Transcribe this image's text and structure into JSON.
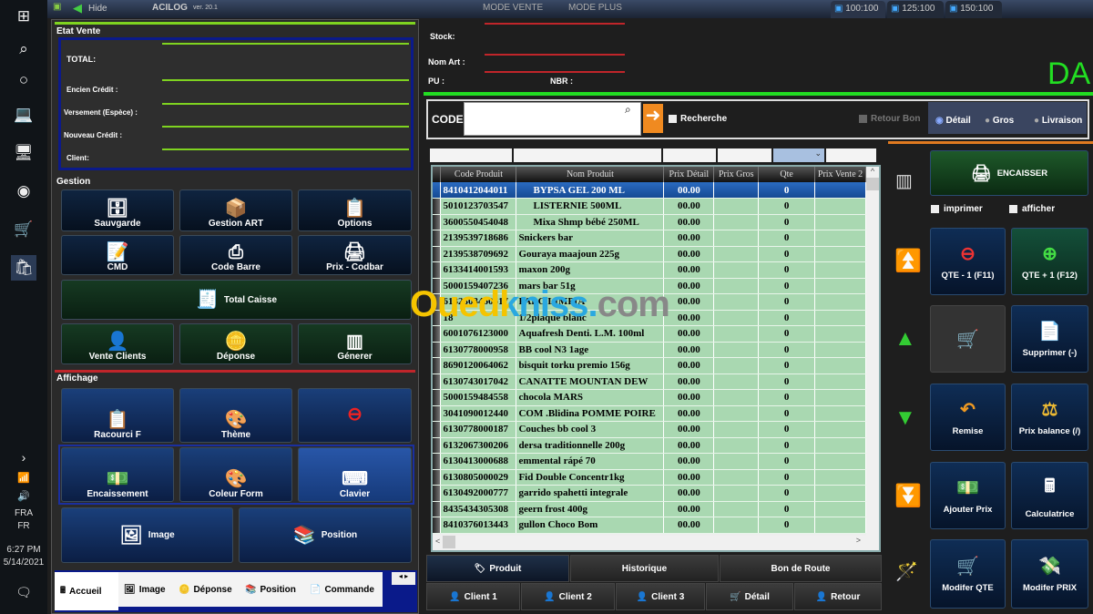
{
  "taskbar": {
    "lang1": "FRA",
    "lang2": "FR",
    "time": "6:27 PM",
    "date": "5/14/2021"
  },
  "titlebar": {
    "hide": "Hide",
    "app": "ACILOG",
    "version": "ver. 20.1",
    "mode_vente": "MODE VENTE",
    "mode_plus": "MODE PLUS",
    "zoom_tabs": [
      "100:100",
      "125:100",
      "150:100"
    ]
  },
  "etat": {
    "title": "Etat Vente",
    "total": "TOTAL:",
    "ancien": "Encien Crédit :",
    "versement": "Versement (Espèce) :",
    "nouveau": "Nouveau Crédit :",
    "client": "Client:"
  },
  "gestion": {
    "title": "Gestion",
    "buttons": [
      "Sauvgarde",
      "Gestion ART",
      "Options",
      "CMD",
      "Code Barre",
      "Prix - Codbar",
      "Total Caisse",
      "Vente Clients",
      "Déponse",
      "Génerer"
    ]
  },
  "affichage": {
    "title": "Affichage",
    "buttons": [
      "Racourci F",
      "Thème",
      "",
      "Encaissement",
      "Coleur Form",
      "Clavier",
      "Image",
      "Position"
    ]
  },
  "bottom_tabs": [
    "Accueil",
    "Image",
    "Déponse",
    "Position",
    "Commande"
  ],
  "info": {
    "stock": "Stock:",
    "nom_art": "Nom Art :",
    "pu": "PU :",
    "nbr": "NBR :",
    "currency": "DA"
  },
  "search": {
    "code_label": "CODE",
    "code_value": "",
    "recherche": "Recherche",
    "retour_bon": "Retour Bon",
    "modes": [
      "Détail",
      "Gros",
      "Livraison"
    ],
    "selected_mode": "Détail"
  },
  "grid": {
    "columns": [
      "Code Produit",
      "Nom Produit",
      "Prix Détail",
      "Prix Gros",
      "Qte",
      "Prix Vente 2"
    ],
    "rows": [
      [
        "8410412044011",
        "BYPSA GEL 200 ML",
        "00.00",
        "",
        "0"
      ],
      [
        "5010123703547",
        "LISTERNIE 500ML",
        "00.00",
        "",
        "0"
      ],
      [
        "3600550454048",
        "Mixa Shmp bébé 250ML",
        "00.00",
        "",
        "0"
      ],
      [
        "2139539718686",
        "Snickers bar",
        "00.00",
        "",
        "0"
      ],
      [
        "2139538709692",
        "Gouraya maajoun 225g",
        "00.00",
        "",
        "0"
      ],
      [
        "6133414001593",
        "maxon  200g",
        "00.00",
        "",
        "0"
      ],
      [
        "5000159407236",
        "mars bar 51g",
        "00.00",
        "",
        "0"
      ],
      [
        "6132503460617",
        "PALC LIMPIA",
        "00.00",
        "",
        "0"
      ],
      [
        "18",
        "1/2plaque blanc",
        "00.00",
        "",
        "0"
      ],
      [
        "6001076123000",
        "Aquafresh Denti. L.M. 100ml",
        "00.00",
        "",
        "0"
      ],
      [
        "6130778000958",
        "BB cool N3 1age",
        "00.00",
        "",
        "0"
      ],
      [
        "8690120064062",
        "bisquit torku premio 156g",
        "00.00",
        "",
        "0"
      ],
      [
        "6130743017042",
        "CANATTE MOUNTAN DEW",
        "00.00",
        "",
        "0"
      ],
      [
        "5000159484558",
        "chocola MARS",
        "00.00",
        "",
        "0"
      ],
      [
        "3041090012440",
        "COM .Blidina POMME POIRE",
        "00.00",
        "",
        "0"
      ],
      [
        "6130778000187",
        "Couches  bb cool 3",
        "00.00",
        "",
        "0"
      ],
      [
        "6132067300206",
        "dersa traditionnelle 200g",
        "00.00",
        "",
        "0"
      ],
      [
        "6130413000688",
        "emmental rápé 70",
        "00.00",
        "",
        "0"
      ],
      [
        "6130805000029",
        "Fid Double Concentr1kg",
        "00.00",
        "",
        "0"
      ],
      [
        "6130492000777",
        "garrido spahetti integrale",
        "00.00",
        "",
        "0"
      ],
      [
        "8435434305308",
        "geern frost 400g",
        "00.00",
        "",
        "0"
      ],
      [
        "8410376013443",
        "gullon Choco Bom",
        "00.00",
        "",
        "0"
      ]
    ]
  },
  "mid_tabs": [
    "Produit",
    "Historique",
    "Bon de Route"
  ],
  "clients": [
    "Client 1",
    "Client 2",
    "Client 3",
    "Détail",
    "Retour"
  ],
  "right": {
    "encaisser": "ENCAISSER",
    "imprimer": "imprimer",
    "afficher": "afficher",
    "buttons": [
      "QTE - 1 (F11)",
      "QTE + 1 (F12)",
      "",
      "Supprimer (-)",
      "Remise",
      "Prix balance (/)",
      "Ajouter Prix",
      "Calculatrice",
      "Modifer QTE",
      "Modifer PRIX"
    ]
  },
  "watermark": "Ouedkniss.com"
}
